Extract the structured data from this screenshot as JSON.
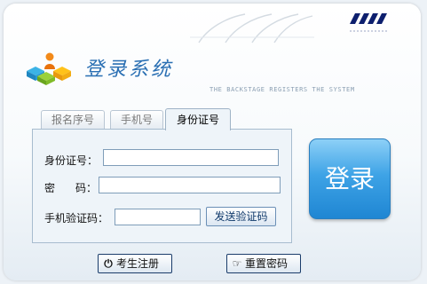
{
  "header": {
    "title": "登录系统",
    "subtitle": "THE BACKSTAGE REGISTERS THE SYSTEM",
    "logo_icon": "colored-blocks-person-logo",
    "decoration_icon": "stripes-decoration"
  },
  "tabs": [
    {
      "label": "报名序号",
      "active": false
    },
    {
      "label": "手机号",
      "active": false
    },
    {
      "label": "身份证号",
      "active": true
    }
  ],
  "form": {
    "id_label": "身份证号：",
    "id_value": "",
    "password_label_1": "密",
    "password_label_2": "码：",
    "password_value": "",
    "sms_label": "手机验证码：",
    "sms_value": "",
    "send_code_label": "发送验证码"
  },
  "login_label": "登录",
  "bottom_buttons": {
    "register_label": "考生注册",
    "register_icon": "power-icon",
    "reset_label": "重置密码",
    "reset_icon": "pointing-hand-icon"
  },
  "colors": {
    "title": "#2a6fb3",
    "login_button": "#3ea3e6",
    "form_background": "#eef4f9"
  }
}
